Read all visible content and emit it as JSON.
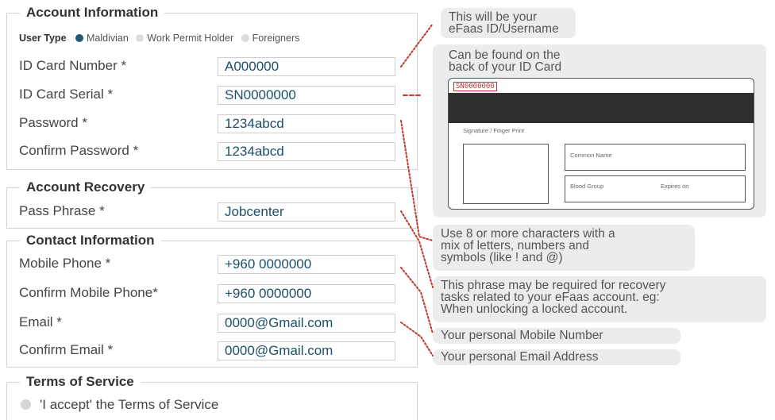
{
  "account_info": {
    "legend": "Account Information",
    "user_type": {
      "label": "User Type",
      "options": [
        "Maldivian",
        "Work Permit Holder",
        "Foreigners"
      ],
      "selected": "Maldivian"
    },
    "fields": [
      {
        "label": "ID Card Number *",
        "value": "A000000"
      },
      {
        "label": "ID Card Serial *",
        "value": "SN0000000"
      },
      {
        "label": "Password *",
        "value": "1234abcd"
      },
      {
        "label": "Confirm Password *",
        "value": "1234abcd"
      }
    ]
  },
  "account_recovery": {
    "legend": "Account Recovery",
    "fields": [
      {
        "label": "Pass Phrase *",
        "value": "Jobcenter"
      }
    ]
  },
  "contact_info": {
    "legend": "Contact Information",
    "fields": [
      {
        "label": "Mobile Phone *",
        "value": "+960 0000000"
      },
      {
        "label": "Confirm Mobile Phone*",
        "value": "+960 0000000"
      },
      {
        "label": "Email *",
        "value": "0000@Gmail.com"
      },
      {
        "label": "Confirm Email *",
        "value": "0000@Gmail.com"
      }
    ]
  },
  "terms": {
    "legend": "Terms of Service",
    "accept_label": "'I accept' the Terms of Service"
  },
  "notes": {
    "efaas_id": "This will be your\neFaas ID/Username",
    "id_card_hint": "Can be found on the\nback of your ID Card",
    "password_rule": "Use 8 or more characters with a\nmix of letters, numbers and\nsymbols (like ! and @)",
    "phrase_hint": "This phrase may be required for recovery\ntasks related to your eFaas account. eg:\nWhen unlocking a locked account.",
    "mobile_hint": "Your personal Mobile Number",
    "email_hint": "Your personal Email Address"
  },
  "id_card": {
    "serial": "SN0000000",
    "signature_label": "Signature / Finger Print",
    "common_name_label": "Common Name",
    "blood_group_label": "Blood Group",
    "expires_label": "Expires on"
  },
  "colors": {
    "accent": "#1f5a78",
    "connector": "#c0392b",
    "note_bg": "#ececec",
    "border": "#d4d4d4"
  }
}
